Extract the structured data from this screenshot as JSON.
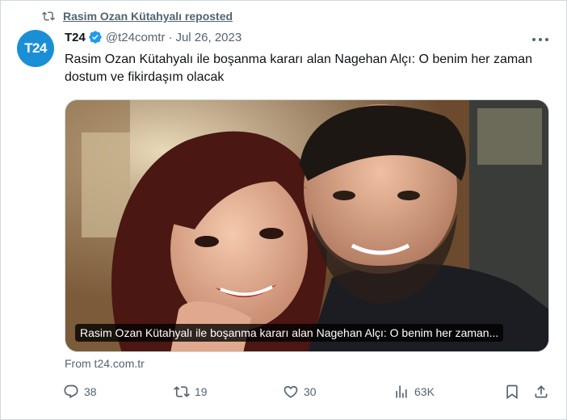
{
  "repost": {
    "label": "Rasim Ozan Kütahyalı reposted",
    "icon": "repost-icon"
  },
  "author": {
    "avatar_text": "T24",
    "name": "T24",
    "verified": true,
    "handle": "@t24comtr",
    "separator": "·",
    "date": "Jul 26, 2023"
  },
  "tweet": {
    "text": "Rasim Ozan Kütahyalı ile boşanma kararı alan Nagehan Alçı: O benim her zaman dostum ve fikirdaşım olacak"
  },
  "media": {
    "caption": "Rasim Ozan Kütahyalı ile boşanma kararı alan Nagehan Alçı: O benim her zaman..."
  },
  "source": "From t24.com.tr",
  "actions": {
    "replies": "38",
    "reposts": "19",
    "likes": "30",
    "views": "63K"
  },
  "colors": {
    "accent": "#1d9bf0",
    "avatar_bg": "#1a8fd6",
    "text_primary": "#0f1419",
    "text_secondary": "#536471",
    "border": "#cfd9de"
  }
}
